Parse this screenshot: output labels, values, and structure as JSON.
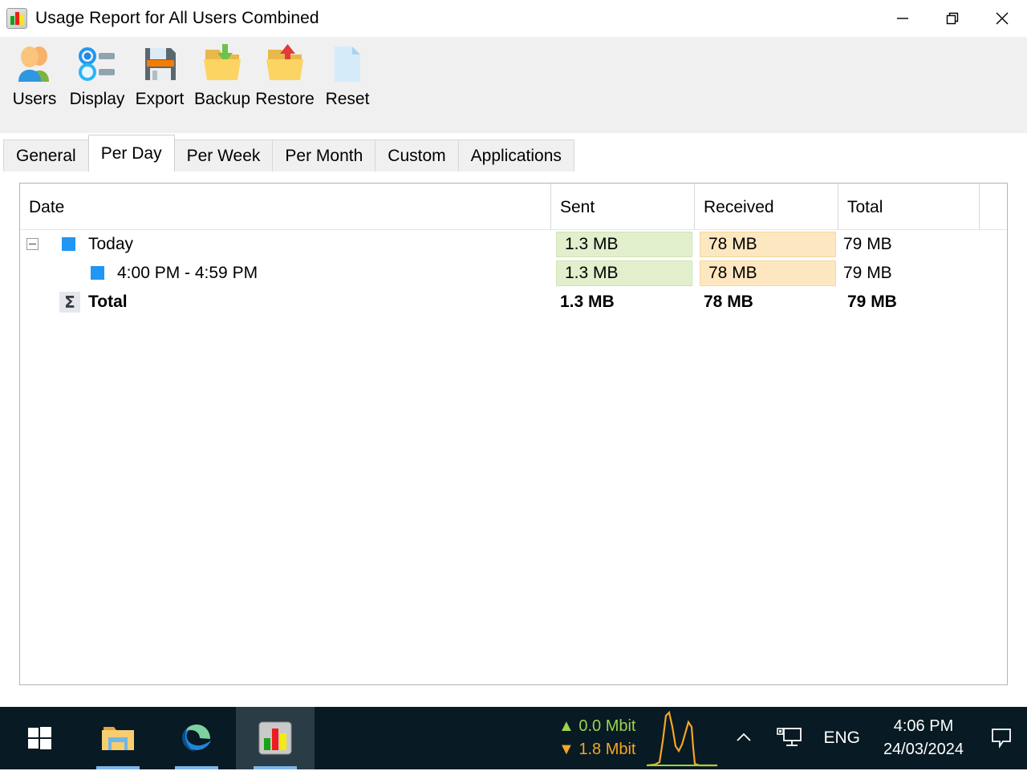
{
  "window": {
    "title": "Usage Report for All Users Combined",
    "app_icon": "bar-chart-icon",
    "controls": {
      "minimize": "minimize-icon",
      "restore": "restore-icon",
      "close": "close-icon"
    }
  },
  "toolbar": {
    "items": [
      {
        "label": "Users",
        "icon": "users-icon"
      },
      {
        "label": "Display",
        "icon": "display-list-icon"
      },
      {
        "label": "Export",
        "icon": "floppy-save-icon"
      },
      {
        "label": "Backup",
        "icon": "folder-download-icon"
      },
      {
        "label": "Restore",
        "icon": "folder-upload-icon"
      },
      {
        "label": "Reset",
        "icon": "blank-document-icon"
      }
    ]
  },
  "tabs": {
    "items": [
      {
        "label": "General",
        "active": false
      },
      {
        "label": "Per Day",
        "active": true
      },
      {
        "label": "Per Week",
        "active": false
      },
      {
        "label": "Per Month",
        "active": false
      },
      {
        "label": "Custom",
        "active": false
      },
      {
        "label": "Applications",
        "active": false
      }
    ]
  },
  "table": {
    "columns": [
      "Date",
      "Sent",
      "Received",
      "Total"
    ],
    "rows": [
      {
        "kind": "group",
        "expander": "collapse-box",
        "icon": "blue-square-icon",
        "date": "Today",
        "sent": "1.3 MB",
        "received": "78 MB",
        "total": "79 MB"
      },
      {
        "kind": "child",
        "icon": "blue-square-icon",
        "date": "4:00 PM - 4:59 PM",
        "sent": "1.3 MB",
        "received": "78 MB",
        "total": "79 MB"
      },
      {
        "kind": "total",
        "icon": "sigma-icon",
        "date": "Total",
        "sent": "1.3 MB",
        "received": "78 MB",
        "total": "79 MB"
      }
    ]
  },
  "colors": {
    "sent_chip_bg": "#e2efcd",
    "sent_chip_border": "#cfe3b3",
    "received_chip_bg": "#fde7c0",
    "received_chip_border": "#f6d79c",
    "tree_square": "#2196f3",
    "taskbar_bg": "#081a23",
    "upload_green": "#9ad44b",
    "download_orange": "#f5a623"
  },
  "taskbar": {
    "buttons": [
      {
        "name": "start-button",
        "icon": "windows-logo-icon"
      },
      {
        "name": "file-explorer-button",
        "icon": "folder-icon"
      },
      {
        "name": "edge-button",
        "icon": "edge-icon"
      },
      {
        "name": "networx-button",
        "icon": "bar-chart-icon"
      }
    ],
    "network": {
      "upload": "0.0 Mbit",
      "download": "1.8 Mbit",
      "upload_arrow": "triangle-up-icon",
      "download_arrow": "triangle-down-icon",
      "graph": "network-activity-graph"
    },
    "tray": {
      "show_hidden": "chevron-up-icon",
      "network_icon": "network-monitor-icon",
      "language": "ENG",
      "time": "4:06 PM",
      "date": "24/03/2024",
      "action_center": "action-center-icon"
    }
  }
}
